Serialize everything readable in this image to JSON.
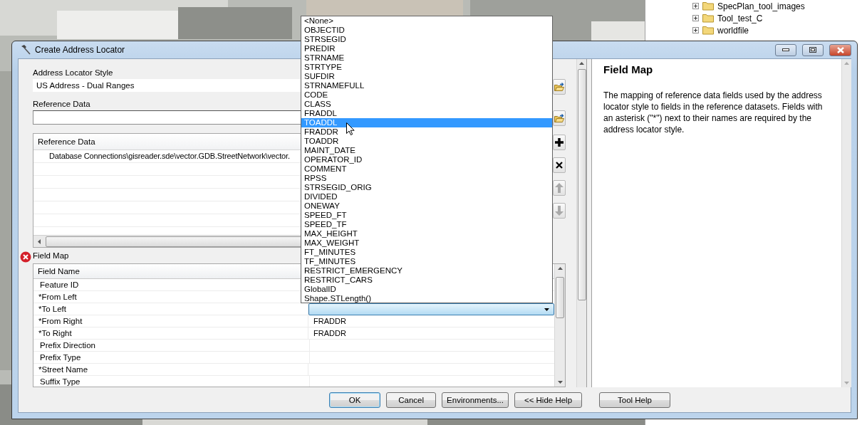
{
  "window": {
    "title": "Create Address Locator"
  },
  "background": {
    "kind": "picture",
    "tree": [
      {
        "label": "SpecPlan_tool_images",
        "expanded": false
      },
      {
        "label": "Tool_test_C",
        "expanded": false
      },
      {
        "label": "worldfile",
        "expanded": false
      }
    ]
  },
  "form": {
    "locator_style": {
      "label": "Address Locator Style",
      "value": "US Address - Dual Ranges"
    },
    "reference_data": {
      "label": "Reference Data"
    },
    "reference_table": {
      "columns": [
        "Reference Data"
      ],
      "rows": [
        "Database Connections\\gisreader.sde\\vector.GDB.StreetNetwork\\vector."
      ]
    },
    "field_map": {
      "label": "Field Map",
      "error": true,
      "columns": [
        "Field Name"
      ],
      "rows": [
        {
          "name": "Feature ID",
          "editing": false
        },
        {
          "name": "*From Left",
          "editing": false
        },
        {
          "name": "*To Left",
          "editing": true
        },
        {
          "name": "*From Right",
          "value": "FRADDR",
          "editing": false
        },
        {
          "name": "*To Right",
          "value": "FRADDR",
          "editing": false
        },
        {
          "name": "Prefix Direction",
          "editing": false
        },
        {
          "name": "Prefix Type",
          "editing": false
        },
        {
          "name": "*Street Name",
          "editing": false
        },
        {
          "name": "Suffix Type",
          "editing": false
        }
      ]
    }
  },
  "dropdown": {
    "items": [
      {
        "label": "<None>",
        "selected": false
      },
      {
        "label": "OBJECTID",
        "selected": false
      },
      {
        "label": "STRSEGID",
        "selected": false
      },
      {
        "label": "PREDIR",
        "selected": false
      },
      {
        "label": "STRNAME",
        "selected": false
      },
      {
        "label": "STRTYPE",
        "selected": false
      },
      {
        "label": "SUFDIR",
        "selected": false
      },
      {
        "label": "STRNAMEFULL",
        "selected": false
      },
      {
        "label": "CODE",
        "selected": false
      },
      {
        "label": "CLASS",
        "selected": false
      },
      {
        "label": "FRADDL",
        "selected": false
      },
      {
        "label": "TOADDL",
        "selected": true
      },
      {
        "label": "FRADDR",
        "selected": false
      },
      {
        "label": "TOADDR",
        "selected": false
      },
      {
        "label": "MAINT_DATE",
        "selected": false
      },
      {
        "label": "OPERATOR_ID",
        "selected": false
      },
      {
        "label": "COMMENT",
        "selected": false
      },
      {
        "label": "RPSS",
        "selected": false
      },
      {
        "label": "STRSEGID_ORIG",
        "selected": false
      },
      {
        "label": "DIVIDED",
        "selected": false
      },
      {
        "label": "ONEWAY",
        "selected": false
      },
      {
        "label": "SPEED_FT",
        "selected": false
      },
      {
        "label": "SPEED_TF",
        "selected": false
      },
      {
        "label": "MAX_HEIGHT",
        "selected": false
      },
      {
        "label": "MAX_WEIGHT",
        "selected": false
      },
      {
        "label": "FT_MINUTES",
        "selected": false
      },
      {
        "label": "TF_MINUTES",
        "selected": false
      },
      {
        "label": "RESTRICT_EMERGENCY",
        "selected": false
      },
      {
        "label": "RESTRICT_CARS",
        "selected": false
      },
      {
        "label": "GlobalID",
        "selected": false
      },
      {
        "label": "Shape.STLength()",
        "selected": false
      }
    ]
  },
  "buttons": [
    {
      "label": "OK",
      "default": true
    },
    {
      "label": "Cancel",
      "default": false
    },
    {
      "label": "Environments...",
      "default": false
    },
    {
      "label": "<< Hide Help",
      "default": false
    }
  ],
  "help_button": "Tool Help",
  "help": {
    "title": "Field Map",
    "text": "The mapping of reference data fields used by the address locator style to fields in the reference datasets. Fields with an asterisk (\"*\") next to their names are required by the address locator style."
  }
}
